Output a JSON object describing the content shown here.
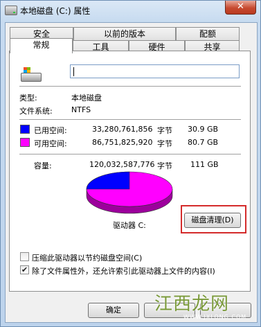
{
  "window": {
    "title": "本地磁盘 (C:) 属性",
    "close_glyph": "✕"
  },
  "tabs_row1": [
    "安全",
    "以前的版本",
    "配额"
  ],
  "tabs_row2": [
    "常规",
    "工具",
    "硬件",
    "共享"
  ],
  "active_tab": "常规",
  "drive": {
    "name_value": ""
  },
  "info": {
    "type_label": "类型:",
    "type_value": "本地磁盘",
    "fs_label": "文件系统:",
    "fs_value": "NTFS"
  },
  "space": {
    "used": {
      "label": "已用空间:",
      "bytes": "33,280,761,856",
      "unit": "字节",
      "human": "30.9 GB",
      "color": "#0000ff"
    },
    "free": {
      "label": "可用空间:",
      "bytes": "86,751,825,920",
      "unit": "字节",
      "human": "80.7 GB",
      "color": "#ff00ff"
    },
    "capacity": {
      "label": "容量:",
      "bytes": "120,032,587,776",
      "unit": "字节",
      "human": "111 GB"
    }
  },
  "drive_label": "驱动器 C:",
  "cleanup_button": "磁盘清理(D)",
  "options": {
    "compress": {
      "label": "压缩此驱动器以节约磁盘空间(C)",
      "checked": false
    },
    "index": {
      "label": "除了文件属性外，还允许索引此驱动器上文件的内容(I)",
      "checked": true,
      "glyph": "✔"
    }
  },
  "buttons": {
    "ok": "确定"
  },
  "watermark": {
    "text": "江西龙网",
    "sub": "WWW.JXLONG.COM"
  }
}
